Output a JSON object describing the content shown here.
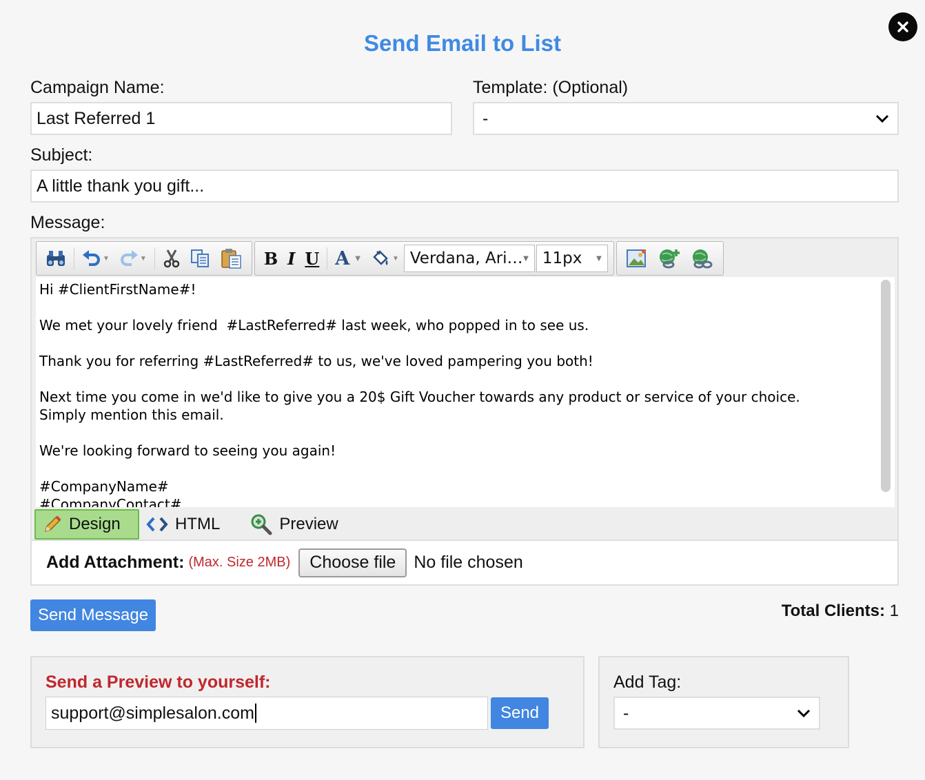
{
  "dialog": {
    "title": "Send Email to List"
  },
  "campaign": {
    "label": "Campaign Name:",
    "value": "Last Referred 1"
  },
  "template": {
    "label": "Template: (Optional)",
    "value": "-"
  },
  "subject": {
    "label": "Subject:",
    "value": "A little thank you gift..."
  },
  "message": {
    "label": "Message:",
    "toolbar": {
      "font_family": "Verdana, Ari…",
      "font_size": "11px",
      "bold": "B",
      "italic": "I",
      "underline": "U",
      "font_color": "A"
    },
    "lines": [
      "Hi #ClientFirstName#!",
      "We met your lovely friend  #LastReferred# last week, who popped in to see us.",
      "Thank you for referring #LastReferred# to us, we've loved pampering you both!",
      "Next time you come in we'd like to give you a 20$ Gift Voucher towards any product or service of your choice. Simply mention this email.",
      "We're looking forward to seeing you again!",
      "#CompanyName#",
      "#CompanyContact#"
    ],
    "tabs": {
      "design": "Design",
      "html": "HTML",
      "preview": "Preview"
    }
  },
  "attachment": {
    "label": "Add Attachment:",
    "hint": "(Max. Size 2MB)",
    "button": "Choose file",
    "status": "No file chosen"
  },
  "send_message": "Send Message",
  "total_clients": {
    "label": "Total Clients:",
    "value": "1"
  },
  "preview_panel": {
    "label": "Send a Preview to yourself:",
    "email": "support@simplesalon.com",
    "send": "Send"
  },
  "tag_panel": {
    "label": "Add Tag:",
    "value": "-"
  },
  "colors": {
    "accent": "#4186e0",
    "title": "#3f8ae3",
    "warning": "#c0272d",
    "active_tab": "#a8dc8c"
  }
}
